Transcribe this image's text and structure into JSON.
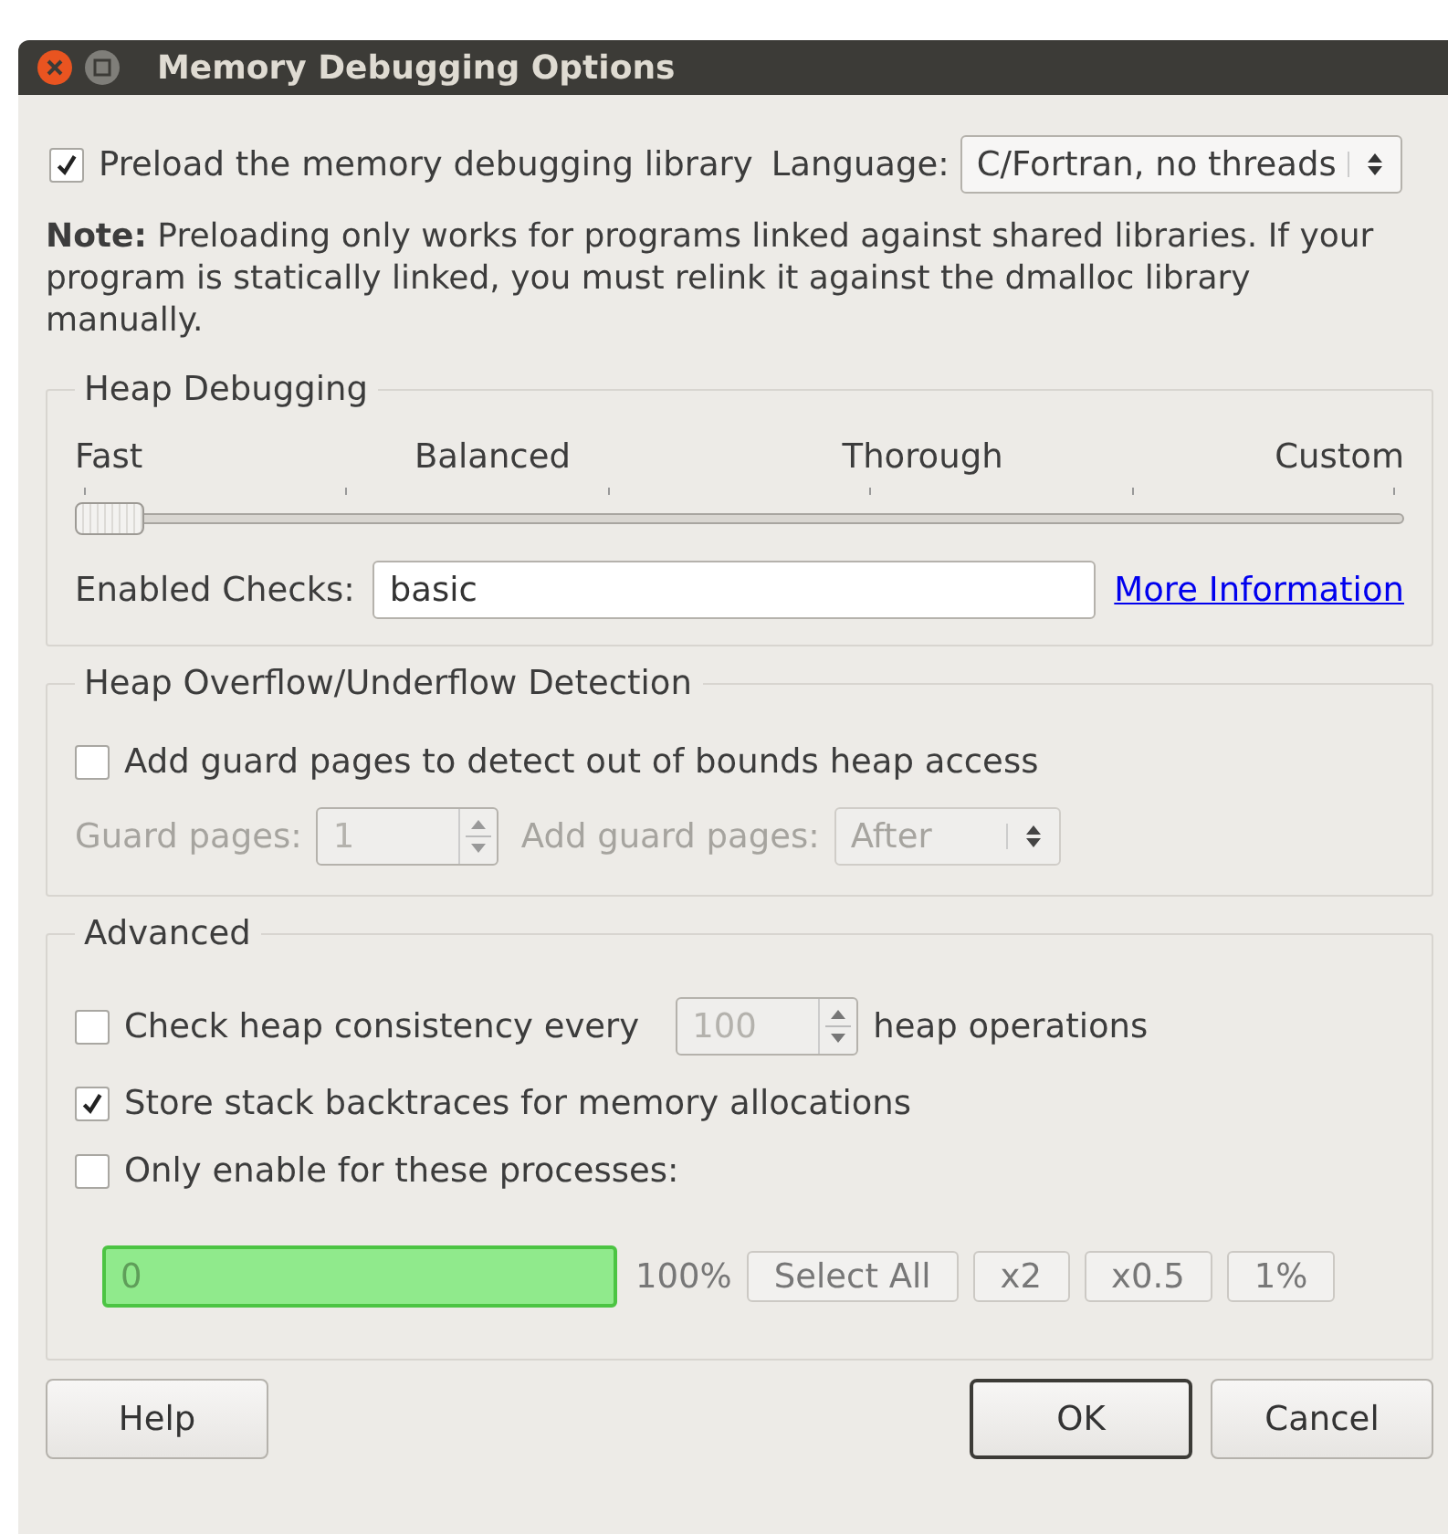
{
  "window": {
    "title": "Memory Debugging Options"
  },
  "preload": {
    "label": "Preload the memory debugging library",
    "checked": true
  },
  "language": {
    "label": "Language:",
    "value": "C/Fortran, no threads"
  },
  "note": "**Note:** Preloading only works for programs linked against shared libraries. If your program is statically linked, you must relink it against the dmalloc library manually.",
  "heap_debugging": {
    "title": "Heap Debugging",
    "slider": {
      "labels": [
        "Fast",
        "Balanced",
        "Thorough",
        "Custom"
      ],
      "level": 0
    },
    "enabled_checks": {
      "label": "Enabled Checks:",
      "value": "basic"
    },
    "link": "More Information"
  },
  "overflow": {
    "title": "Heap Overflow/Underflow Detection",
    "guard": {
      "label": "Add guard pages to detect out of bounds heap access",
      "checked": false
    },
    "guard_pages": {
      "label": "Guard pages:",
      "value": "1",
      "disabled": true
    },
    "add_guard_pages": {
      "label": "Add guard pages:",
      "value": "After",
      "disabled": true
    }
  },
  "advanced": {
    "title": "Advanced",
    "options": [
      {
        "kind": "spin",
        "label": "Check heap consistency every",
        "checked": false,
        "value": "100",
        "suffix": "heap operations",
        "disabled": true
      },
      {
        "kind": "check",
        "label": "Store stack backtraces for memory allocations",
        "checked": true
      },
      {
        "kind": "check",
        "label": "Only enable for these processes:",
        "checked": false
      }
    ],
    "processes": {
      "placeholder": "0",
      "percent": "100%",
      "buttons": [
        "Select All",
        "x2",
        "x0.5",
        "1%"
      ]
    }
  },
  "buttons": [
    {
      "label": "Help",
      "default": false
    },
    {
      "label": "OK",
      "default": true
    },
    {
      "label": "Cancel",
      "default": false
    }
  ]
}
